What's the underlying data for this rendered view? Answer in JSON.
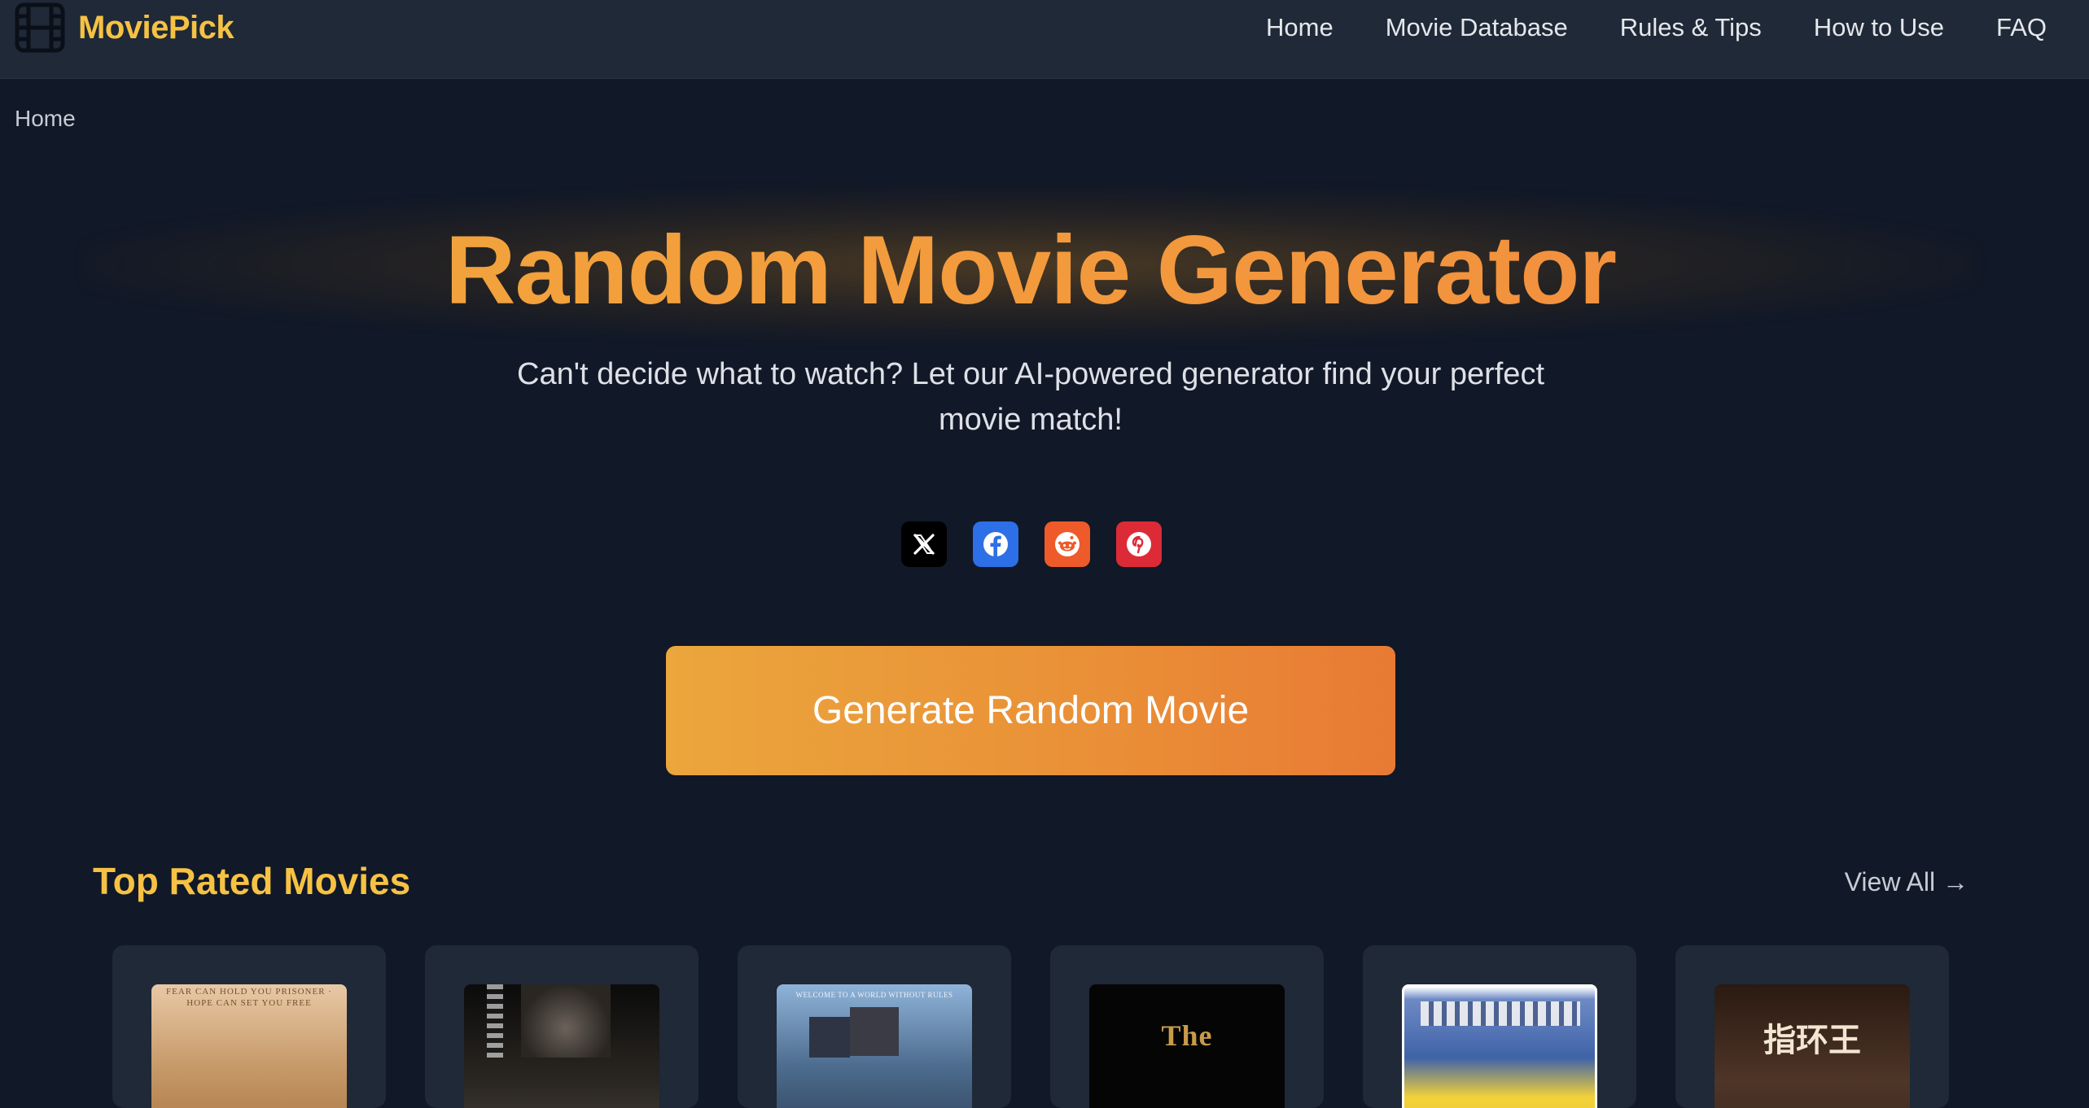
{
  "app": {
    "brand": "MoviePick",
    "accent_color": "#f6c244",
    "background_color": "#111827",
    "header_color": "#1f2937"
  },
  "nav": {
    "items": [
      "Home",
      "Movie Database",
      "Rules & Tips",
      "How to Use",
      "FAQ"
    ]
  },
  "breadcrumb": {
    "current": "Home"
  },
  "hero": {
    "title": "Random Movie Generator",
    "subtitle": "Can't decide what to watch? Let our AI-powered generator find your perfect movie match!"
  },
  "share": {
    "buttons": [
      {
        "icon": "x-icon",
        "color": "#000000"
      },
      {
        "icon": "facebook-icon",
        "color": "#2d6fe6"
      },
      {
        "icon": "reddit-icon",
        "color": "#ee5a29"
      },
      {
        "icon": "pinterest-icon",
        "color": "#dc2b37"
      }
    ]
  },
  "cta": {
    "label": "Generate Random Movie"
  },
  "top_rated": {
    "title": "Top Rated Movies",
    "view_all": "View All →",
    "posters": [
      {
        "text": "FEAR CAN HOLD YOU PRISONER · HOPE CAN SET YOU FREE"
      },
      {
        "text": ""
      },
      {
        "text": "WELCOME TO A WORLD WITHOUT RULES"
      },
      {
        "text": "The"
      },
      {
        "text": ""
      },
      {
        "text": "指环王"
      }
    ]
  }
}
